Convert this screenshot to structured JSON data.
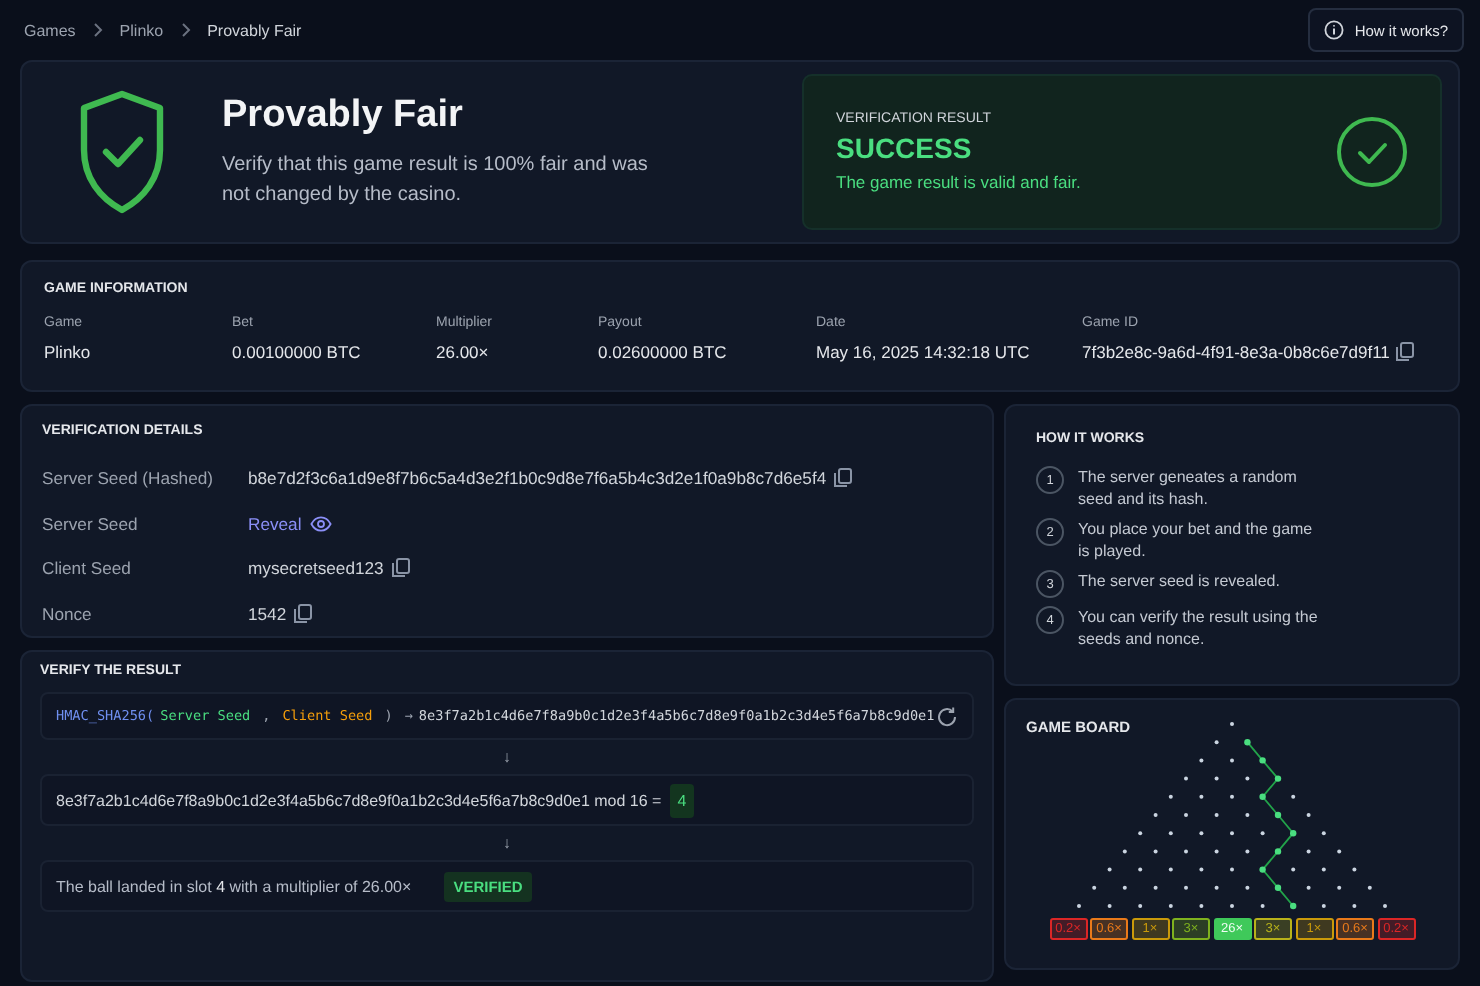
{
  "breadcrumbs": [
    "Games",
    "Plinko",
    "Provably Fair"
  ],
  "help_button": "How it works?",
  "hero": {
    "title": "Provably Fair",
    "subtitle": "Verify that this game result is 100% fair and was not changed by the casino."
  },
  "result": {
    "label": "VERIFICATION RESULT",
    "status": "SUCCESS",
    "message": "The game result is valid and fair."
  },
  "game_information": {
    "title": "GAME INFORMATION",
    "fields": [
      {
        "label": "Game",
        "value": "Plinko",
        "kind": "text"
      },
      {
        "label": "Bet",
        "value": "0.00100000 BTC",
        "kind": "text"
      },
      {
        "label": "Multiplier",
        "value": "26.00×",
        "kind": "text"
      },
      {
        "label": "Payout",
        "value": "0.02600000 BTC",
        "kind": "text"
      },
      {
        "label": "Date",
        "value": "May 16, 2025 14:32:18 UTC",
        "kind": "text"
      },
      {
        "label": "Game ID",
        "value": "7f3b2e8c-9a6d-4f91-8e3a-0b8c6e7d9f11",
        "kind": "copyable"
      }
    ]
  },
  "verification_details": {
    "title": "VERIFICATION DETAILS",
    "rows": [
      {
        "label": "Server Seed (Hashed)",
        "value": "b8e7d2f3c6a1d9e8f7b6c5a4d3e2f1b0c9d8e7f6a5b4c3d2e1f0a9b8c7d6e5f4",
        "kind": "copyable"
      },
      {
        "label": "Server Seed",
        "value": "Reveal",
        "kind": "reveal"
      },
      {
        "label": "Client Seed",
        "value": "mysecretseed123",
        "kind": "copyable"
      },
      {
        "label": "Nonce",
        "value": "1542",
        "kind": "copyable"
      }
    ]
  },
  "verify": {
    "title": "VERIFY THE RESULT",
    "formula": {
      "function": "HMAC_SHA256(",
      "arg_1": "Server Seed",
      "separator": ",",
      "arg_2": "Client Seed",
      "close": ")",
      "arrow": "→",
      "hash": "8e3f7a2b1c4d6e7f8a9b0c1d2e3f4a5b6c7d8e9f0a1b2c3d4e5f6a7b8c9d0e1"
    },
    "step_arrows": [
      "↓",
      "↓"
    ],
    "modulo": {
      "expression": "8e3f7a2b1c4d6e7f8a9b0c1d2e3f4a5b6c7d8e9f0a1b2c3d4e5f6a7b8c9d0e1 mod 16 =",
      "result": "4"
    },
    "outcome": {
      "text": "The ball landed in slot **4** with a multiplier of 26.00×",
      "badge": "VERIFIED"
    }
  },
  "how_it_works": {
    "title": "HOW IT WORKS",
    "steps": [
      {
        "number": "1",
        "text": "The server geneates a random seed and its hash."
      },
      {
        "number": "2",
        "text": "You place your bet and the game is played."
      },
      {
        "number": "3",
        "text": "The server seed is revealed."
      },
      {
        "number": "4",
        "text": "You can verify the result using the seeds and nonce."
      }
    ]
  },
  "board": {
    "title": "GAME BOARD",
    "slots": [
      {
        "label": "0.2×",
        "color": "#dc2626",
        "selected": false
      },
      {
        "label": "0.6×",
        "color": "#ea7a1a",
        "selected": false
      },
      {
        "label": "1×",
        "color": "#ca9a0a",
        "selected": false
      },
      {
        "label": "3×",
        "color": "#7fb21e",
        "selected": false
      },
      {
        "label": "26×",
        "color": "#3fc95a",
        "selected": true
      },
      {
        "label": "3×",
        "color": "#b8b21a",
        "selected": false
      },
      {
        "label": "1×",
        "color": "#ca9a0a",
        "selected": false
      },
      {
        "label": "0.6×",
        "color": "#ea7a1a",
        "selected": false
      },
      {
        "label": "0.2×",
        "color": "#dc2626",
        "selected": false
      }
    ]
  }
}
